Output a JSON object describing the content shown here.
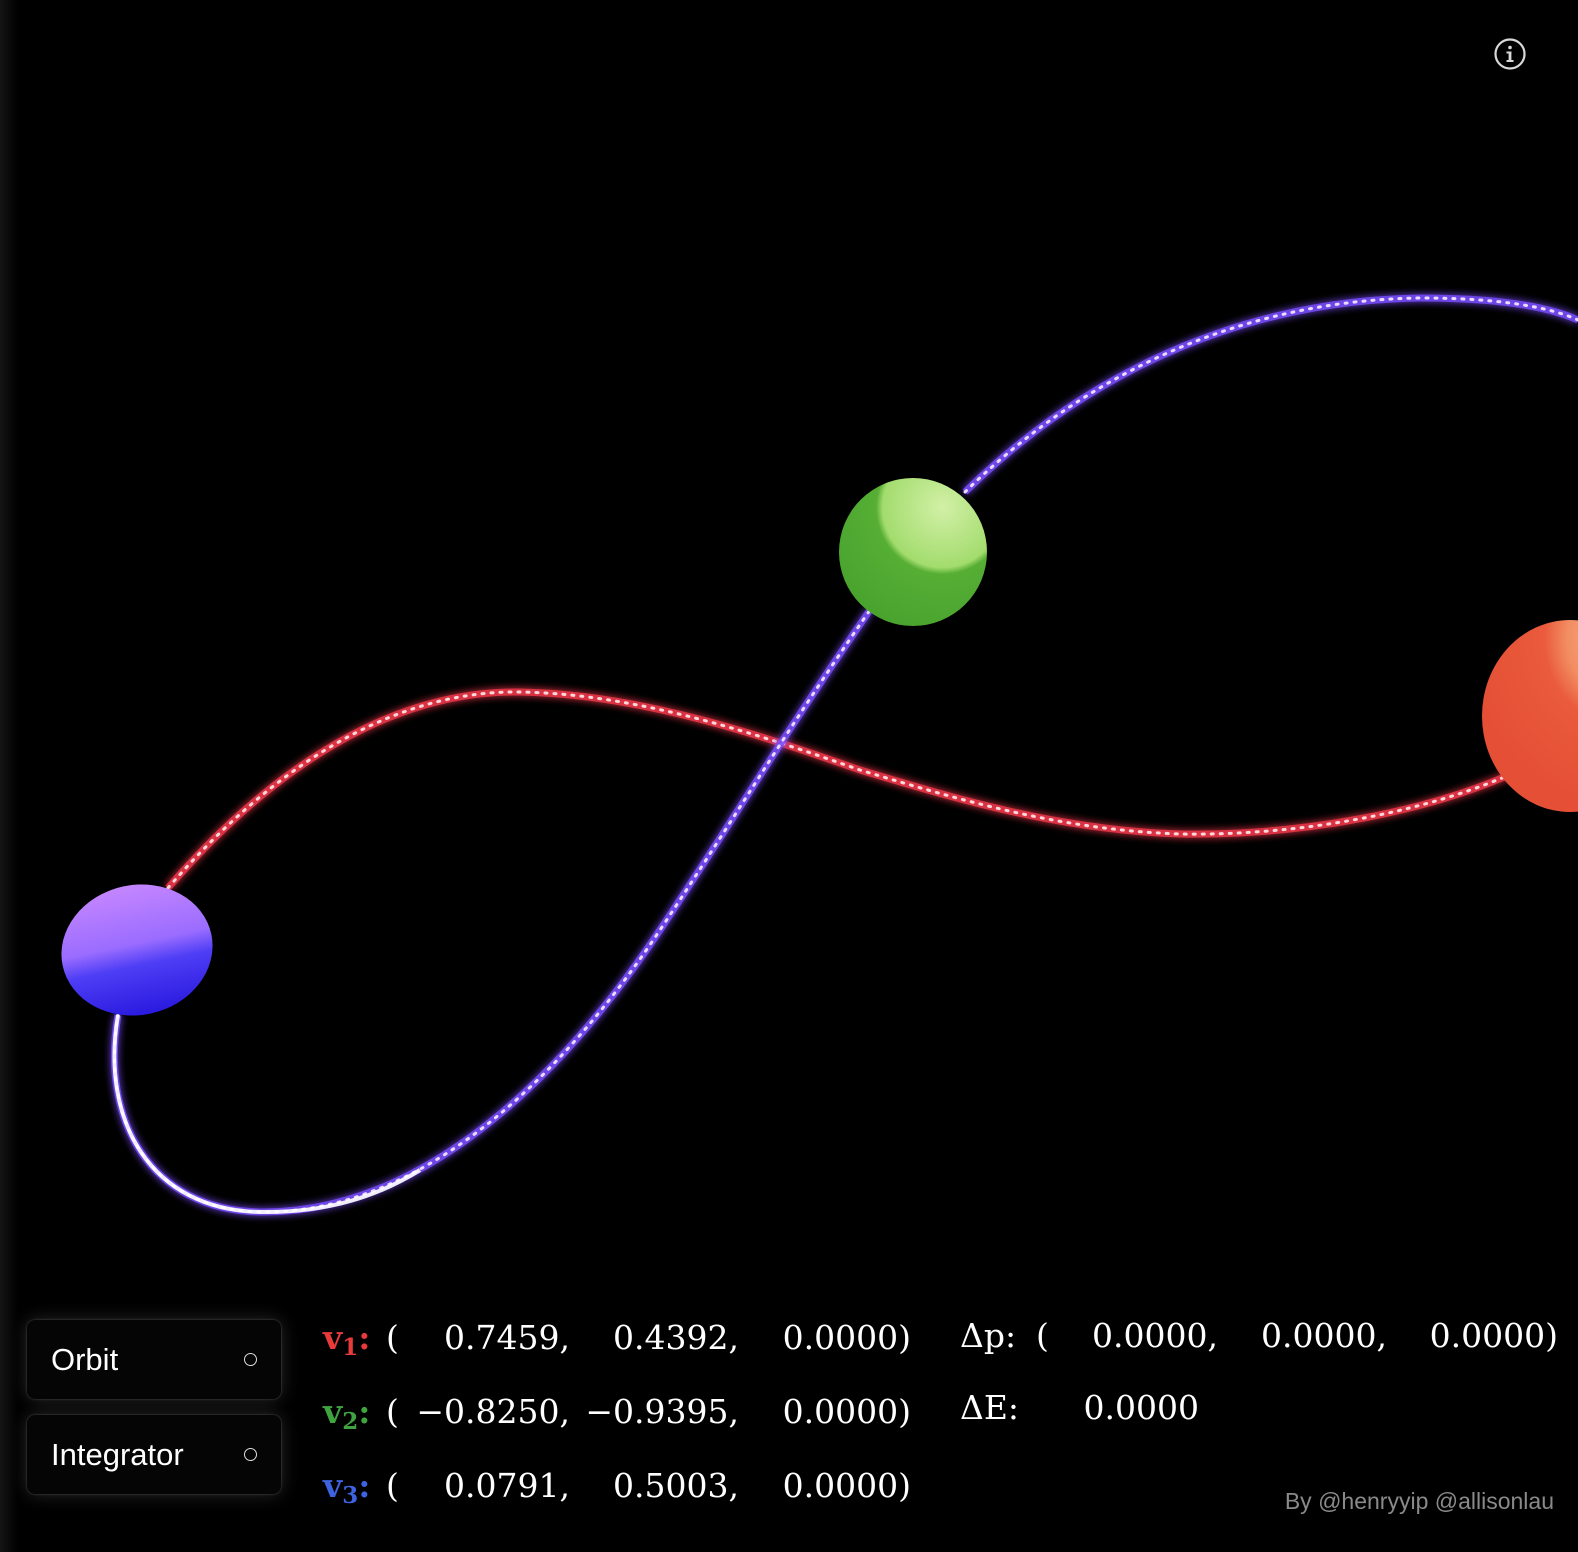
{
  "colors": {
    "background": "#000000",
    "body1": "#e9553a",
    "body2": "#52ab34",
    "body3": "#5b3df0",
    "trail1": "#ff3b50",
    "trail3": "#8a5cff",
    "v1_label": "#e83a3a",
    "v2_label": "#3fa33f",
    "v3_label": "#3d63e0"
  },
  "icons": {
    "info": "info-circle-icon",
    "radio": "radio-circle-icon"
  },
  "controls": {
    "orbit_label": "Orbit",
    "integrator_label": "Integrator"
  },
  "velocities": [
    {
      "label": "v",
      "index": "1",
      "x": "0.7459,",
      "y": "0.4392,",
      "z": "0.0000)"
    },
    {
      "label": "v",
      "index": "2",
      "x": "−0.8250,",
      "y": "−0.9395,",
      "z": "0.0000)"
    },
    {
      "label": "v",
      "index": "3",
      "x": "0.0791,",
      "y": "0.5003,",
      "z": "0.0000)"
    }
  ],
  "open_paren": "(",
  "delta_p": {
    "label": "Δp:",
    "open": "(",
    "x": "0.0000,",
    "y": "0.0000,",
    "z": "0.0000)"
  },
  "delta_e": {
    "label": "ΔE:",
    "value": "0.0000"
  },
  "credit": "By @henryyip @allisonlau"
}
